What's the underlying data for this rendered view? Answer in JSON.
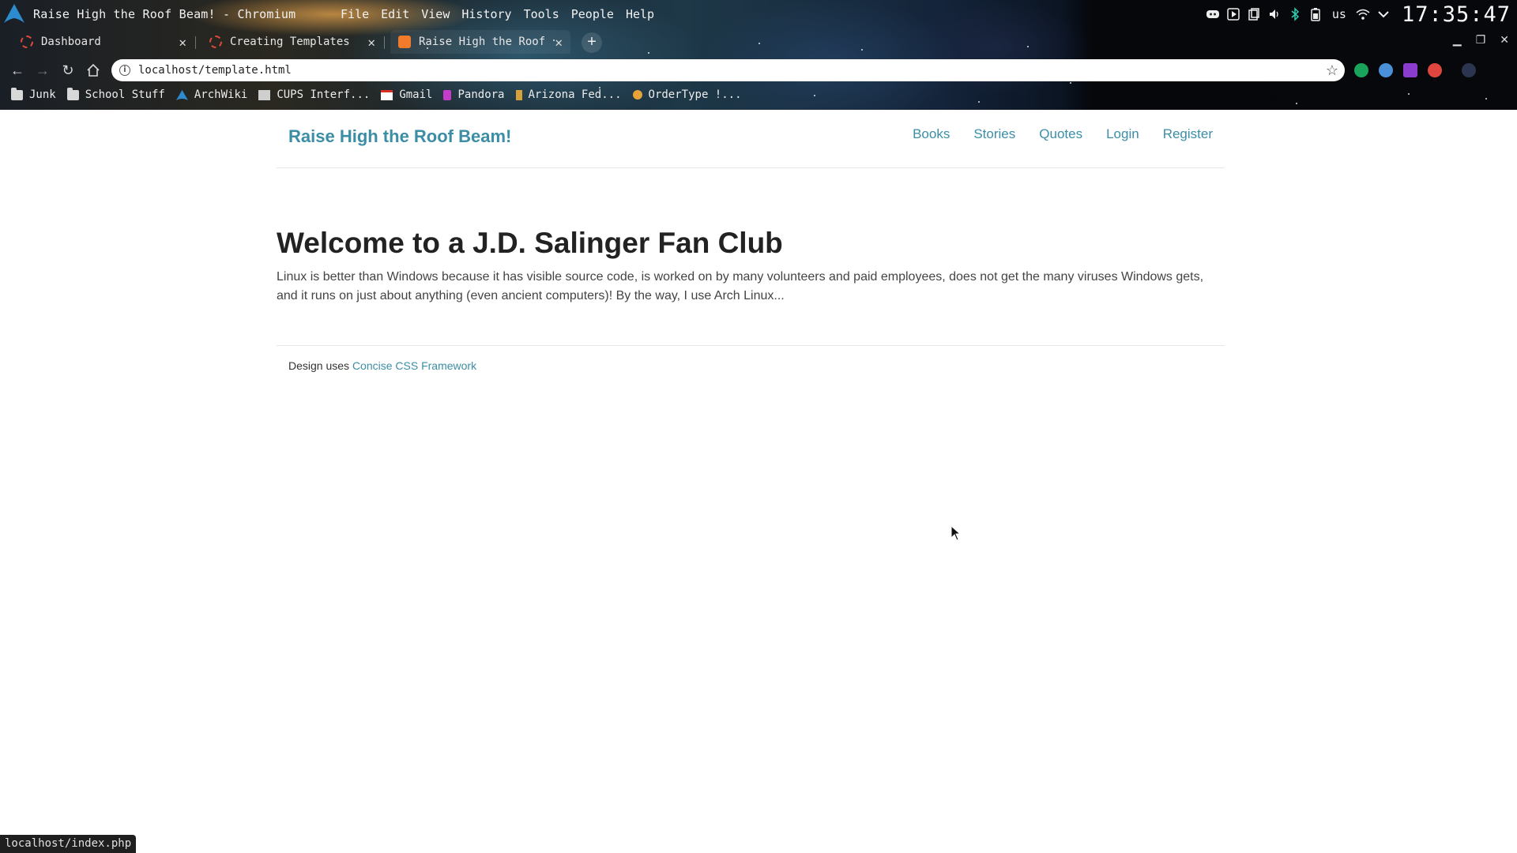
{
  "system_bar": {
    "window_title": "Raise High the Roof Beam! - Chromium",
    "menu": [
      "File",
      "Edit",
      "View",
      "History",
      "Tools",
      "People",
      "Help"
    ],
    "keyboard_layout": "us",
    "clock": "17:35:47"
  },
  "tabs": [
    {
      "label": "Dashboard",
      "active": false
    },
    {
      "label": "Creating Templates",
      "active": false
    },
    {
      "label": "Raise High the Roof",
      "active": true
    }
  ],
  "toolbar": {
    "url": "localhost/template.html"
  },
  "bookmarks": [
    {
      "label": "Junk",
      "icon": "folder-icon"
    },
    {
      "label": "School Stuff",
      "icon": "folder-icon"
    },
    {
      "label": "ArchWiki",
      "icon": "arch-icon"
    },
    {
      "label": "CUPS Interf...",
      "icon": "cups-icon"
    },
    {
      "label": "Gmail",
      "icon": "gmail-icon"
    },
    {
      "label": "Pandora",
      "icon": "pandora-icon"
    },
    {
      "label": "Arizona Fed...",
      "icon": "arizona-icon"
    },
    {
      "label": "OrderType !...",
      "icon": "ordertype-icon"
    }
  ],
  "site": {
    "title": "Raise High the Roof Beam!",
    "nav": [
      "Books",
      "Stories",
      "Quotes",
      "Login",
      "Register"
    ],
    "heading": "Welcome to a J.D. Salinger Fan Club",
    "intro": "Linux is better than Windows because it has visible source code, is worked on by many volunteers and paid employees, does not get the many viruses Windows gets, and it runs on just about anything (even ancient computers)! By the way, I use Arch Linux...",
    "footer_prefix": "Design uses ",
    "footer_link": "Concise CSS Framework"
  },
  "status_url": "localhost/index.php",
  "colors": {
    "link": "#3b8ea5",
    "heading": "#222222"
  }
}
